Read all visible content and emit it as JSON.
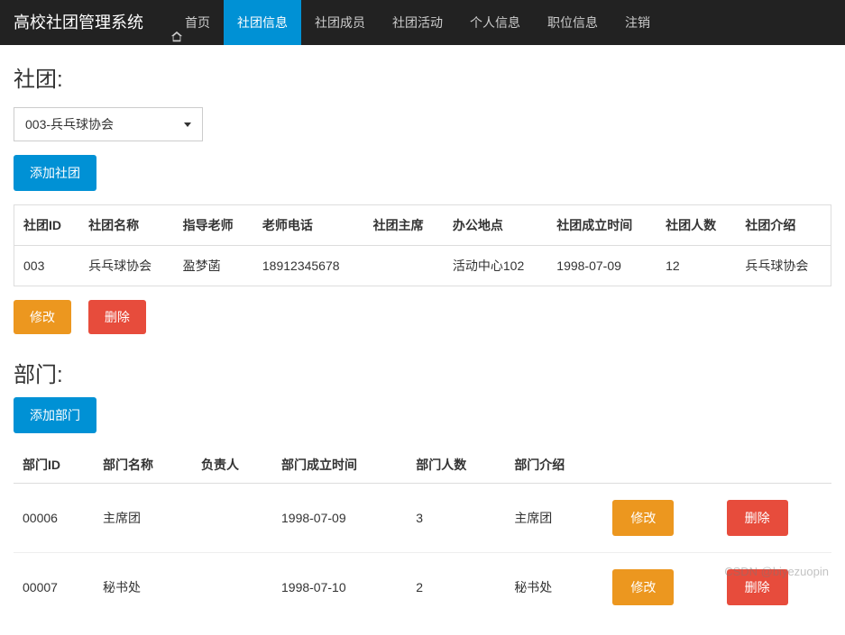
{
  "navbar": {
    "brand": "高校社团管理系统",
    "items": [
      {
        "label": "首页",
        "active": false,
        "icon": "home"
      },
      {
        "label": "社团信息",
        "active": true
      },
      {
        "label": "社团成员",
        "active": false
      },
      {
        "label": "社团活动",
        "active": false
      },
      {
        "label": "个人信息",
        "active": false
      },
      {
        "label": "职位信息",
        "active": false
      },
      {
        "label": "注销",
        "active": false
      }
    ]
  },
  "club_section": {
    "title": "社团:",
    "selected": "003-兵乓球协会",
    "add_button": "添加社团",
    "modify_button": "修改",
    "delete_button": "删除",
    "headers": {
      "id": "社团ID",
      "name": "社团名称",
      "teacher": "指导老师",
      "phone": "老师电话",
      "chair": "社团主席",
      "location": "办公地点",
      "founded": "社团成立时间",
      "count": "社团人数",
      "intro": "社团介绍"
    },
    "row": {
      "id": "003",
      "name": "兵乓球协会",
      "teacher": "盈梦菡",
      "phone": "18912345678",
      "chair": "",
      "location": "活动中心102",
      "founded": "1998-07-09",
      "count": "12",
      "intro": "兵乓球协会"
    }
  },
  "dept_section": {
    "title": "部门:",
    "add_button": "添加部门",
    "modify_button": "修改",
    "delete_button": "删除",
    "headers": {
      "id": "部门ID",
      "name": "部门名称",
      "leader": "负责人",
      "founded": "部门成立时间",
      "count": "部门人数",
      "intro": "部门介绍"
    },
    "rows": [
      {
        "id": "00006",
        "name": "主席团",
        "leader": "",
        "founded": "1998-07-09",
        "count": "3",
        "intro": "主席团"
      },
      {
        "id": "00007",
        "name": "秘书处",
        "leader": "",
        "founded": "1998-07-10",
        "count": "2",
        "intro": "秘书处"
      }
    ]
  },
  "watermark": "CSDN @biyezuopin"
}
